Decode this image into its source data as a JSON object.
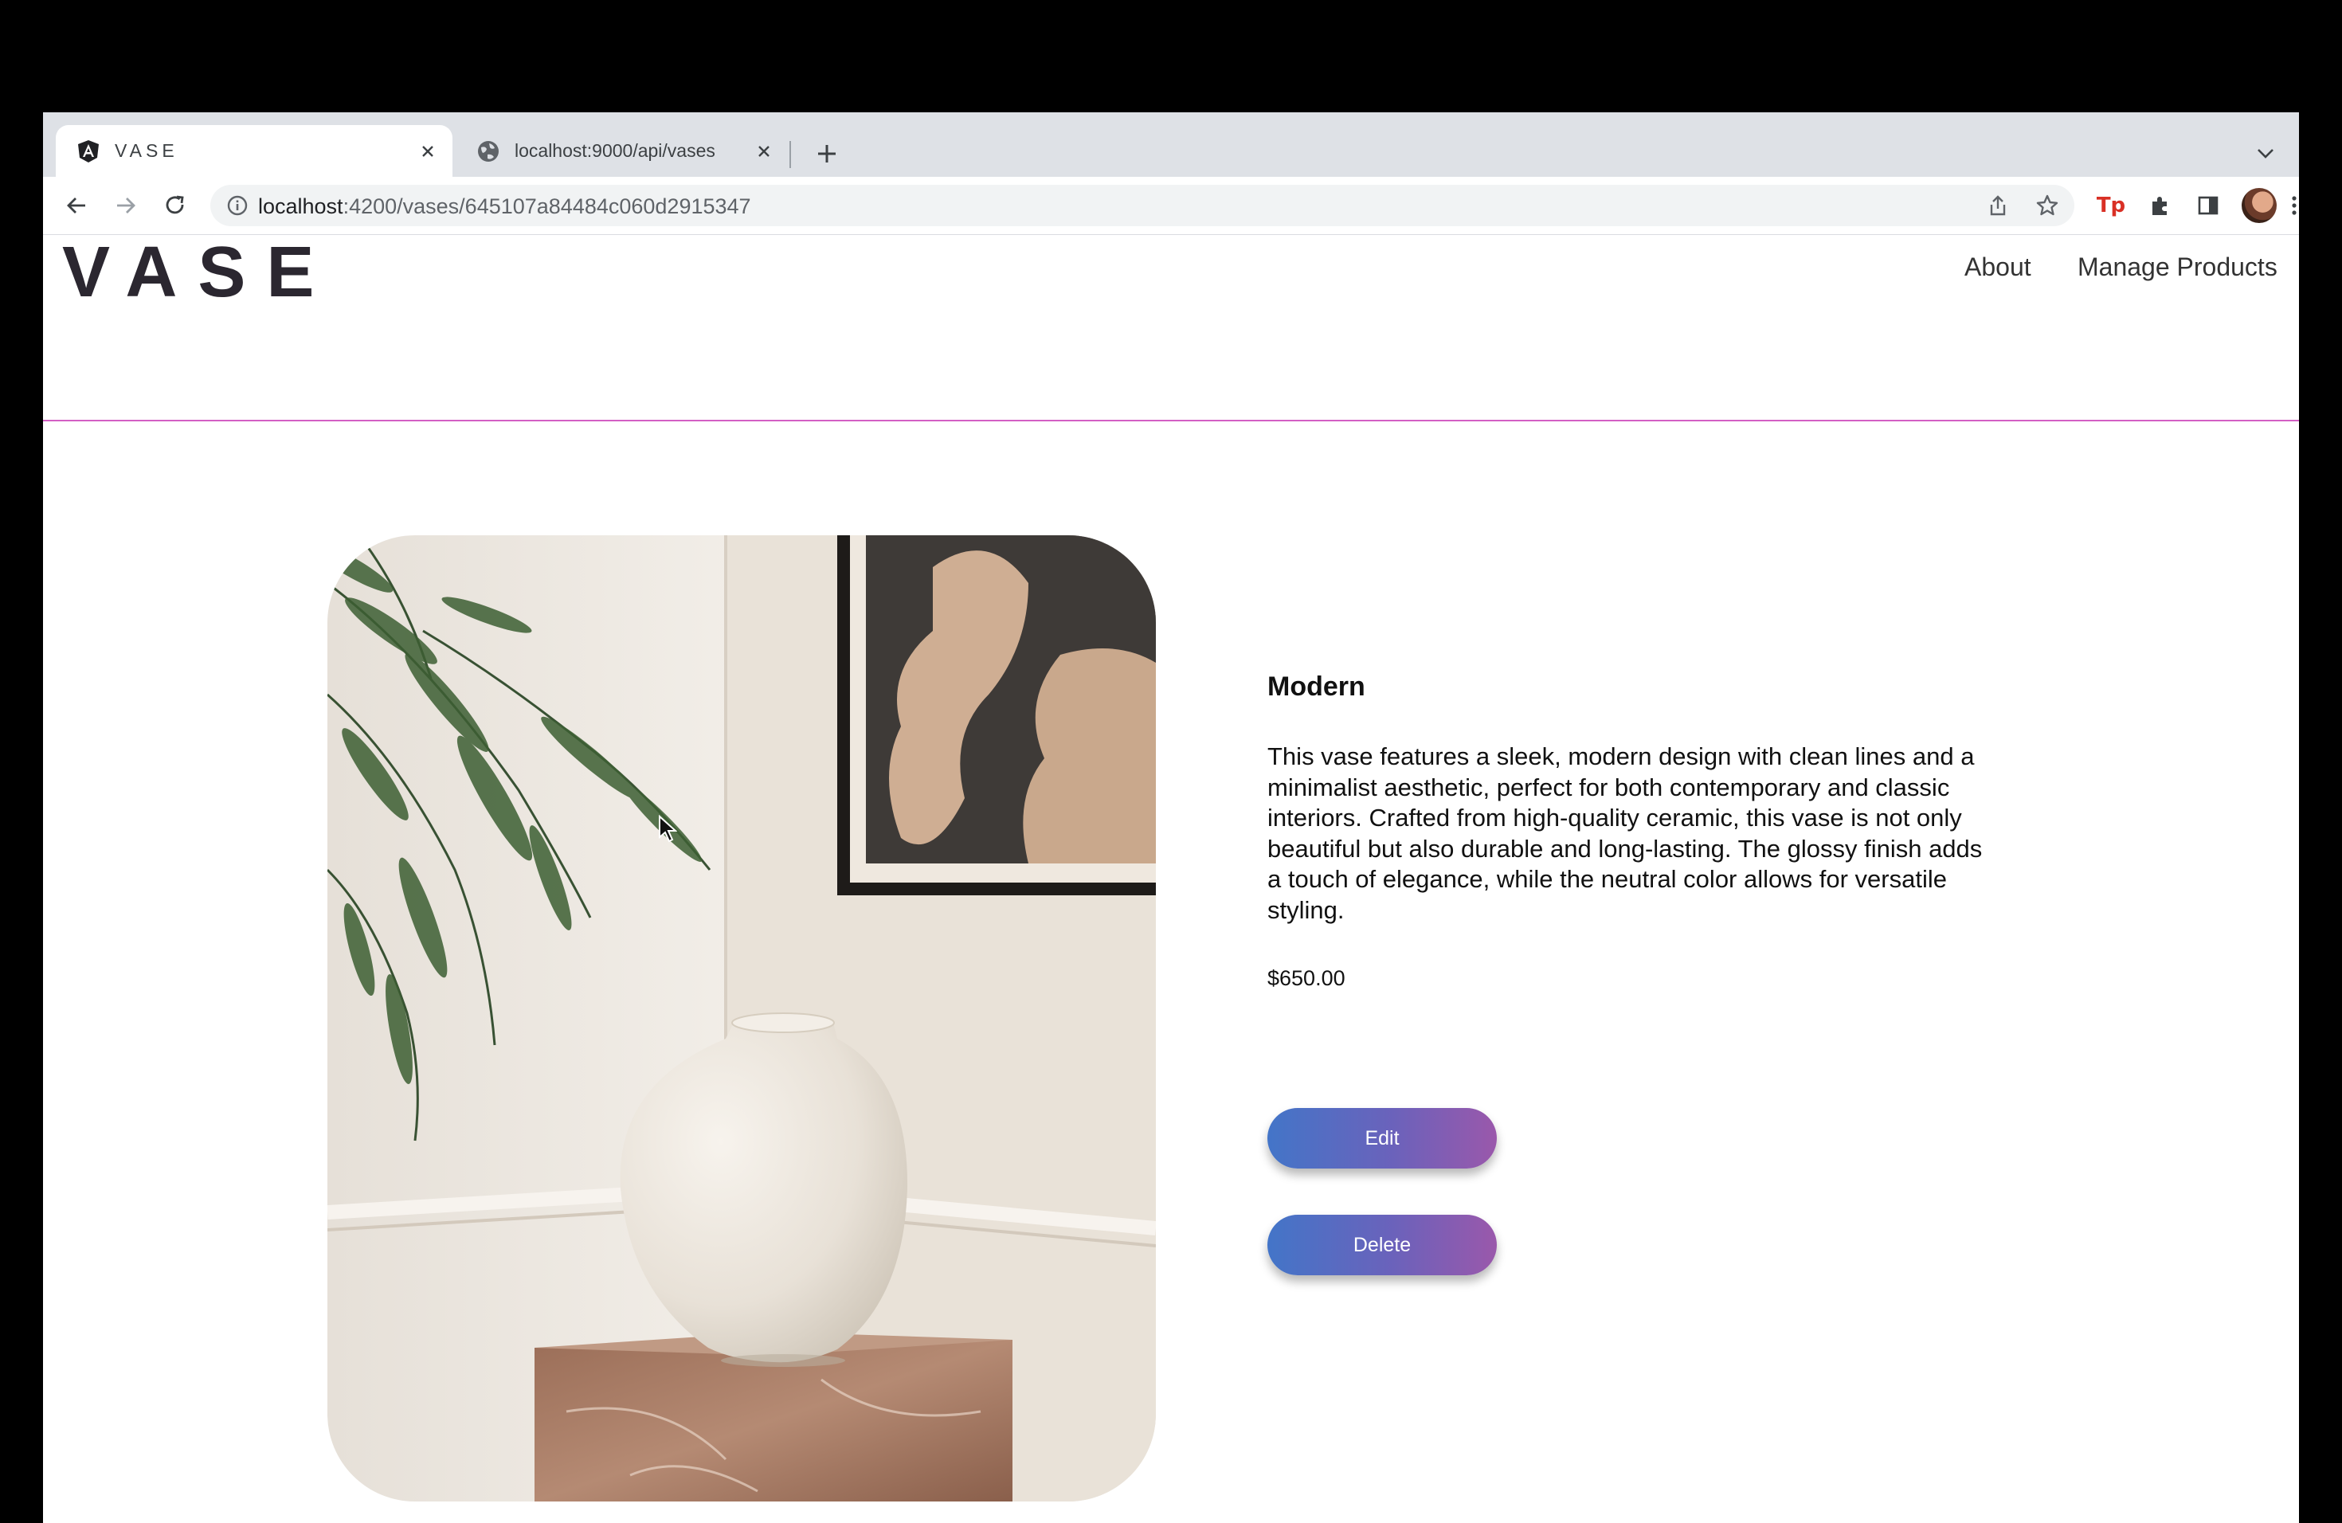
{
  "browser": {
    "tabs": [
      {
        "title": "VASE",
        "active": true,
        "favicon": "angular-icon"
      },
      {
        "title": "localhost:9000/api/vases",
        "active": false,
        "favicon": "globe-icon"
      }
    ],
    "address": {
      "host": "localhost",
      "path": ":4200/vases/645107a84484c060d2915347"
    }
  },
  "site": {
    "logo": "VASE",
    "nav": [
      "About",
      "Manage Products"
    ],
    "accent_color": "#d35fc4"
  },
  "product": {
    "name": "Modern",
    "description": "This vase features a sleek, modern design with clean lines and a minimalist aesthetic, perfect for both contemporary and classic interiors. Crafted from high-quality ceramic, this vase is not only beautiful but also durable and long-lasting. The glossy finish adds a touch of elegance, while the neutral color allows for versatile styling.",
    "price": "$650.00",
    "image_subject": "white ceramic vase on marble pedestal beside fern and framed art"
  },
  "actions": {
    "edit_label": "Edit",
    "delete_label": "Delete",
    "button_gradient": [
      "#4375c8",
      "#9a58ab"
    ]
  }
}
